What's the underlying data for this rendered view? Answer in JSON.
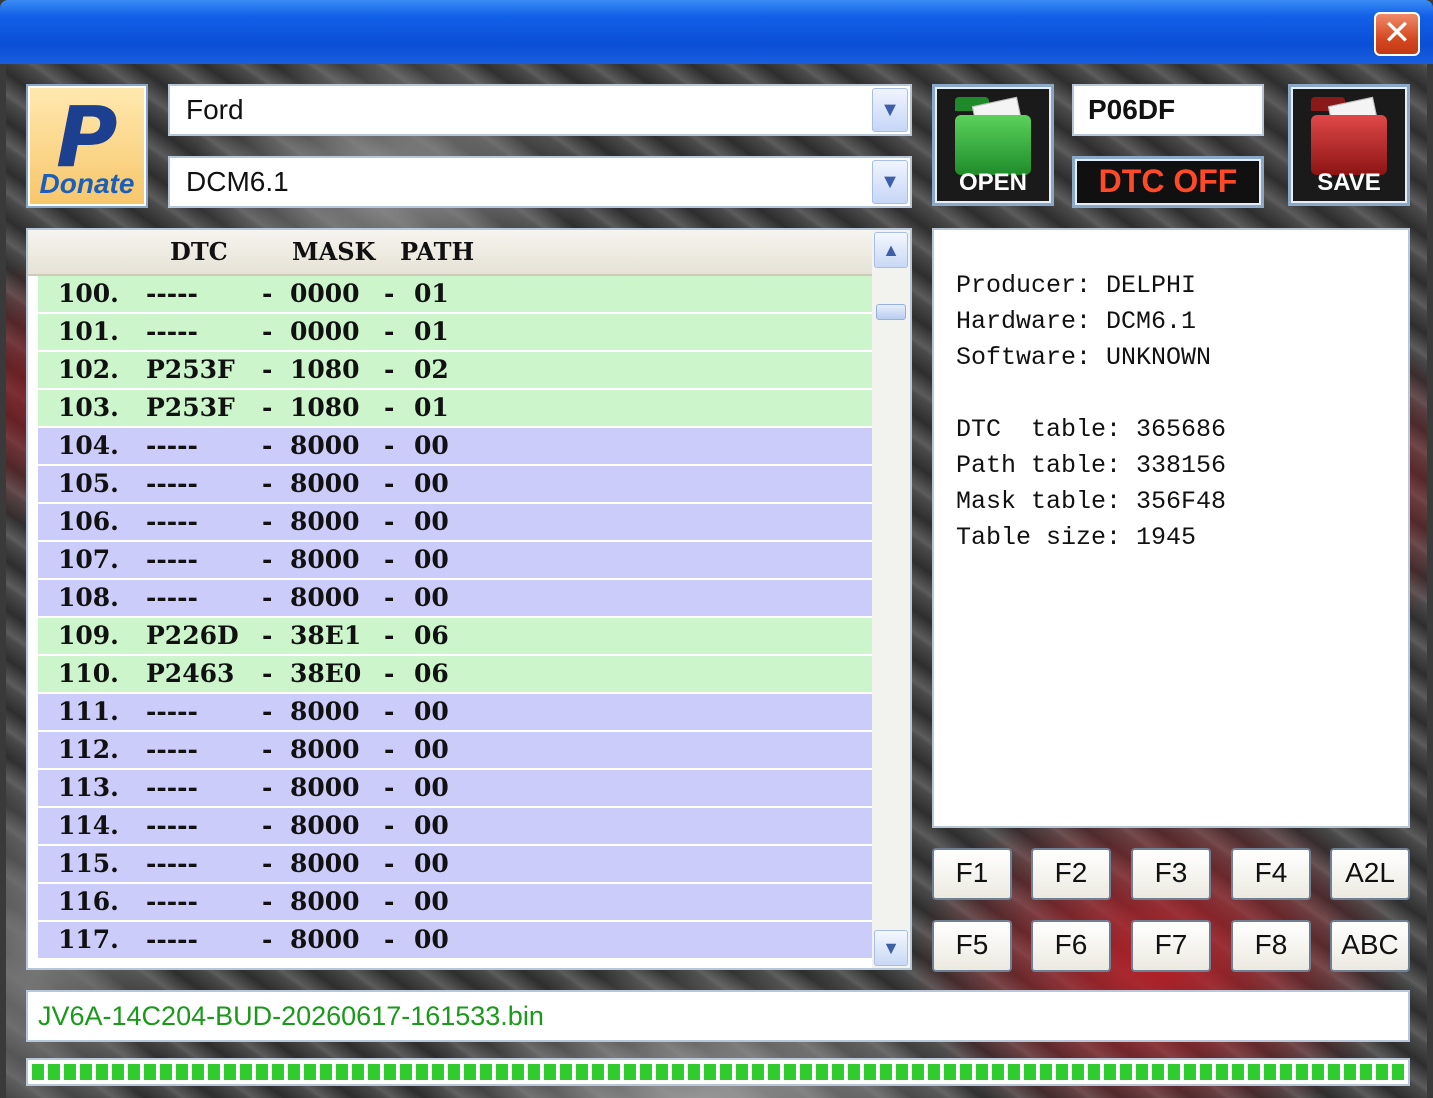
{
  "window": {
    "close_glyph": "✕"
  },
  "donate": {
    "logo_letter": "P",
    "label": "Donate"
  },
  "selectors": {
    "make": "Ford",
    "ecu": "DCM6.1",
    "arrow": "⌄"
  },
  "buttons": {
    "open": "OPEN",
    "dtc_off": "DTC OFF",
    "save": "SAVE"
  },
  "dtc_code": "P06DF",
  "table": {
    "columns": [
      "DTC",
      "MASK",
      "PATH"
    ],
    "rows": [
      {
        "num": "100.",
        "dtc": "-----",
        "mask": "0000",
        "path": "01",
        "state": "green"
      },
      {
        "num": "101.",
        "dtc": "-----",
        "mask": "0000",
        "path": "01",
        "state": "green"
      },
      {
        "num": "102.",
        "dtc": "P253F",
        "mask": "1080",
        "path": "02",
        "state": "green"
      },
      {
        "num": "103.",
        "dtc": "P253F",
        "mask": "1080",
        "path": "01",
        "state": "green"
      },
      {
        "num": "104.",
        "dtc": "-----",
        "mask": "8000",
        "path": "00",
        "state": "blue"
      },
      {
        "num": "105.",
        "dtc": "-----",
        "mask": "8000",
        "path": "00",
        "state": "blue"
      },
      {
        "num": "106.",
        "dtc": "-----",
        "mask": "8000",
        "path": "00",
        "state": "blue"
      },
      {
        "num": "107.",
        "dtc": "-----",
        "mask": "8000",
        "path": "00",
        "state": "blue"
      },
      {
        "num": "108.",
        "dtc": "-----",
        "mask": "8000",
        "path": "00",
        "state": "blue"
      },
      {
        "num": "109.",
        "dtc": "P226D",
        "mask": "38E1",
        "path": "06",
        "state": "green"
      },
      {
        "num": "110.",
        "dtc": "P2463",
        "mask": "38E0",
        "path": "06",
        "state": "green"
      },
      {
        "num": "111.",
        "dtc": "-----",
        "mask": "8000",
        "path": "00",
        "state": "blue"
      },
      {
        "num": "112.",
        "dtc": "-----",
        "mask": "8000",
        "path": "00",
        "state": "blue"
      },
      {
        "num": "113.",
        "dtc": "-----",
        "mask": "8000",
        "path": "00",
        "state": "blue"
      },
      {
        "num": "114.",
        "dtc": "-----",
        "mask": "8000",
        "path": "00",
        "state": "blue"
      },
      {
        "num": "115.",
        "dtc": "-----",
        "mask": "8000",
        "path": "00",
        "state": "blue"
      },
      {
        "num": "116.",
        "dtc": "-----",
        "mask": "8000",
        "path": "00",
        "state": "blue"
      },
      {
        "num": "117.",
        "dtc": "-----",
        "mask": "8000",
        "path": "00",
        "state": "blue"
      }
    ],
    "separator": "-",
    "scroll_up": "⌃",
    "scroll_down": "⌄"
  },
  "info": {
    "lines": [
      "Producer: DELPHI",
      "Hardware: DCM6.1",
      "Software: UNKNOWN",
      "",
      "DTC  table: 365686",
      "Path table: 338156",
      "Mask table: 356F48",
      "Table size: 1945"
    ]
  },
  "function_keys": {
    "row1": [
      "F1",
      "F2",
      "F3",
      "F4",
      "A2L"
    ],
    "row2": [
      "F5",
      "F6",
      "F7",
      "F8",
      "ABC"
    ]
  },
  "file_name": "JV6A-14C204-BUD-20260617-161533.bin",
  "progress": 1.0,
  "colors": {
    "row_green": "#ccf5cc",
    "row_blue": "#ccccfa",
    "filename_green": "#1a9a1a",
    "dtc_off_red": "#ff4a2a"
  }
}
